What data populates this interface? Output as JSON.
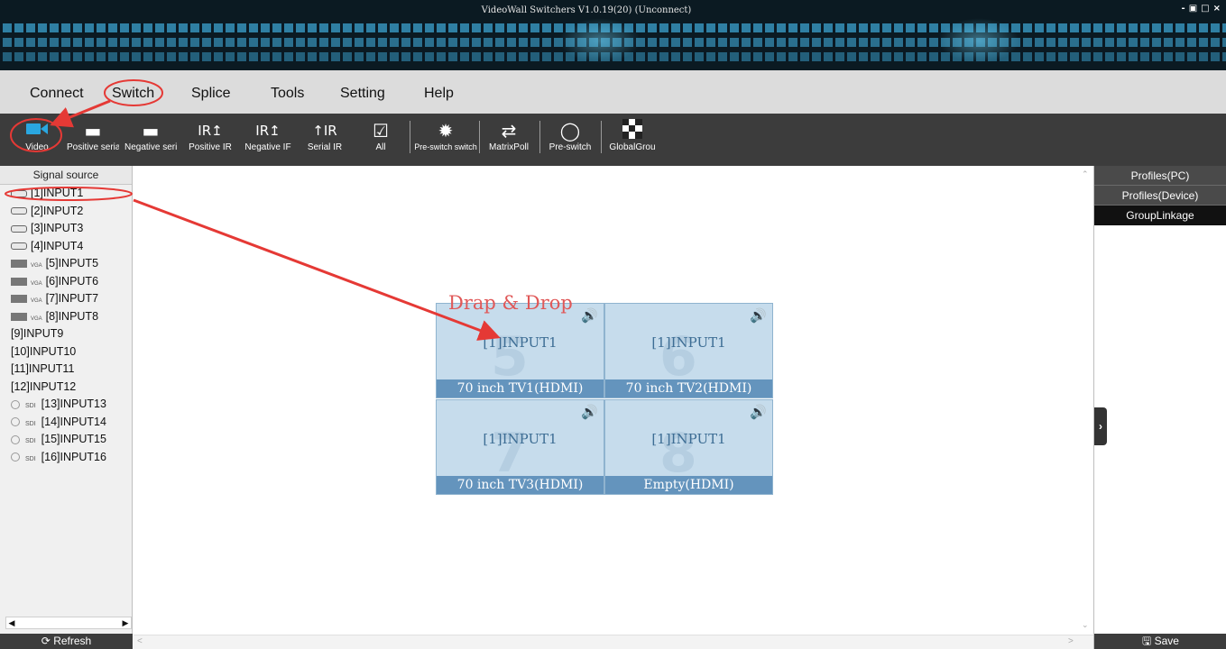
{
  "window": {
    "title": "VideoWall Switchers V1.0.19(20) (Unconnect)",
    "controls": [
      "-",
      "□",
      "▣",
      "×"
    ]
  },
  "menu": [
    "Connect",
    "Switch",
    "Splice",
    "Tools",
    "Setting",
    "Help"
  ],
  "toolbar": [
    {
      "label": "Video",
      "icon": "video-camera-icon"
    },
    {
      "label": "Positive serial",
      "icon": "serial-port-icon"
    },
    {
      "label": "Negative serial",
      "icon": "serial-port-icon"
    },
    {
      "label": "Positive IR",
      "icon": "ir-icon"
    },
    {
      "label": "Negative IF",
      "icon": "ir-icon"
    },
    {
      "label": "Serial IR",
      "icon": "serial-ir-icon"
    },
    {
      "label": "All",
      "icon": "checkbox-icon"
    },
    {
      "label": "Pre-switch switch",
      "icon": "pre-switch-icon"
    },
    {
      "label": "MatrixPoll",
      "icon": "shuffle-icon"
    },
    {
      "label": "Pre-switch",
      "icon": "slider-icon"
    },
    {
      "label": "GlobalGrou",
      "icon": "checker-icon"
    }
  ],
  "signal_source": {
    "title": "Signal source",
    "items": [
      {
        "label": "[1]INPUT1",
        "port": "hdmi"
      },
      {
        "label": "[2]INPUT2",
        "port": "hdmi"
      },
      {
        "label": "[3]INPUT3",
        "port": "hdmi"
      },
      {
        "label": "[4]INPUT4",
        "port": "hdmi"
      },
      {
        "label": "[5]INPUT5",
        "port": "vga"
      },
      {
        "label": "[6]INPUT6",
        "port": "vga"
      },
      {
        "label": "[7]INPUT7",
        "port": "vga"
      },
      {
        "label": "[8]INPUT8",
        "port": "vga"
      },
      {
        "label": "[9]INPUT9",
        "port": "none"
      },
      {
        "label": "[10]INPUT10",
        "port": "none"
      },
      {
        "label": "[11]INPUT11",
        "port": "none"
      },
      {
        "label": "[12]INPUT12",
        "port": "none"
      },
      {
        "label": "[13]INPUT13",
        "port": "sdi"
      },
      {
        "label": "[14]INPUT14",
        "port": "sdi"
      },
      {
        "label": "[15]INPUT15",
        "port": "sdi"
      },
      {
        "label": "[16]INPUT16",
        "port": "sdi"
      }
    ],
    "port_text": {
      "vga": "VGA",
      "sdi": "SDI"
    },
    "refresh_label": "Refresh"
  },
  "annotation": {
    "drag_drop": "Drap & Drop"
  },
  "video_wall": [
    {
      "source": "[1]INPUT1",
      "caption": "70 inch TV1(HDMI)",
      "mark": "5",
      "audio": "speaker-icon"
    },
    {
      "source": "[1]INPUT1",
      "caption": "70 inch TV2(HDMI)",
      "mark": "6",
      "audio": "speaker-icon"
    },
    {
      "source": "[1]INPUT1",
      "caption": "70 inch TV3(HDMI)",
      "mark": "7",
      "audio": "speaker-icon"
    },
    {
      "source": "[1]INPUT1",
      "caption": "Empty(HDMI)",
      "mark": "8",
      "audio": "speaker-icon"
    }
  ],
  "right_panel": {
    "tabs": [
      "Profiles(PC)",
      "Profiles(Device)",
      "GroupLinkage"
    ],
    "active_tab": "GroupLinkage",
    "save_label": "Save"
  },
  "colors": {
    "toolbar_bg": "#3c3c3c",
    "tile_bg": "#c6dcec",
    "tile_caption_bg": "#6494bd",
    "annotation": "#e53935"
  }
}
